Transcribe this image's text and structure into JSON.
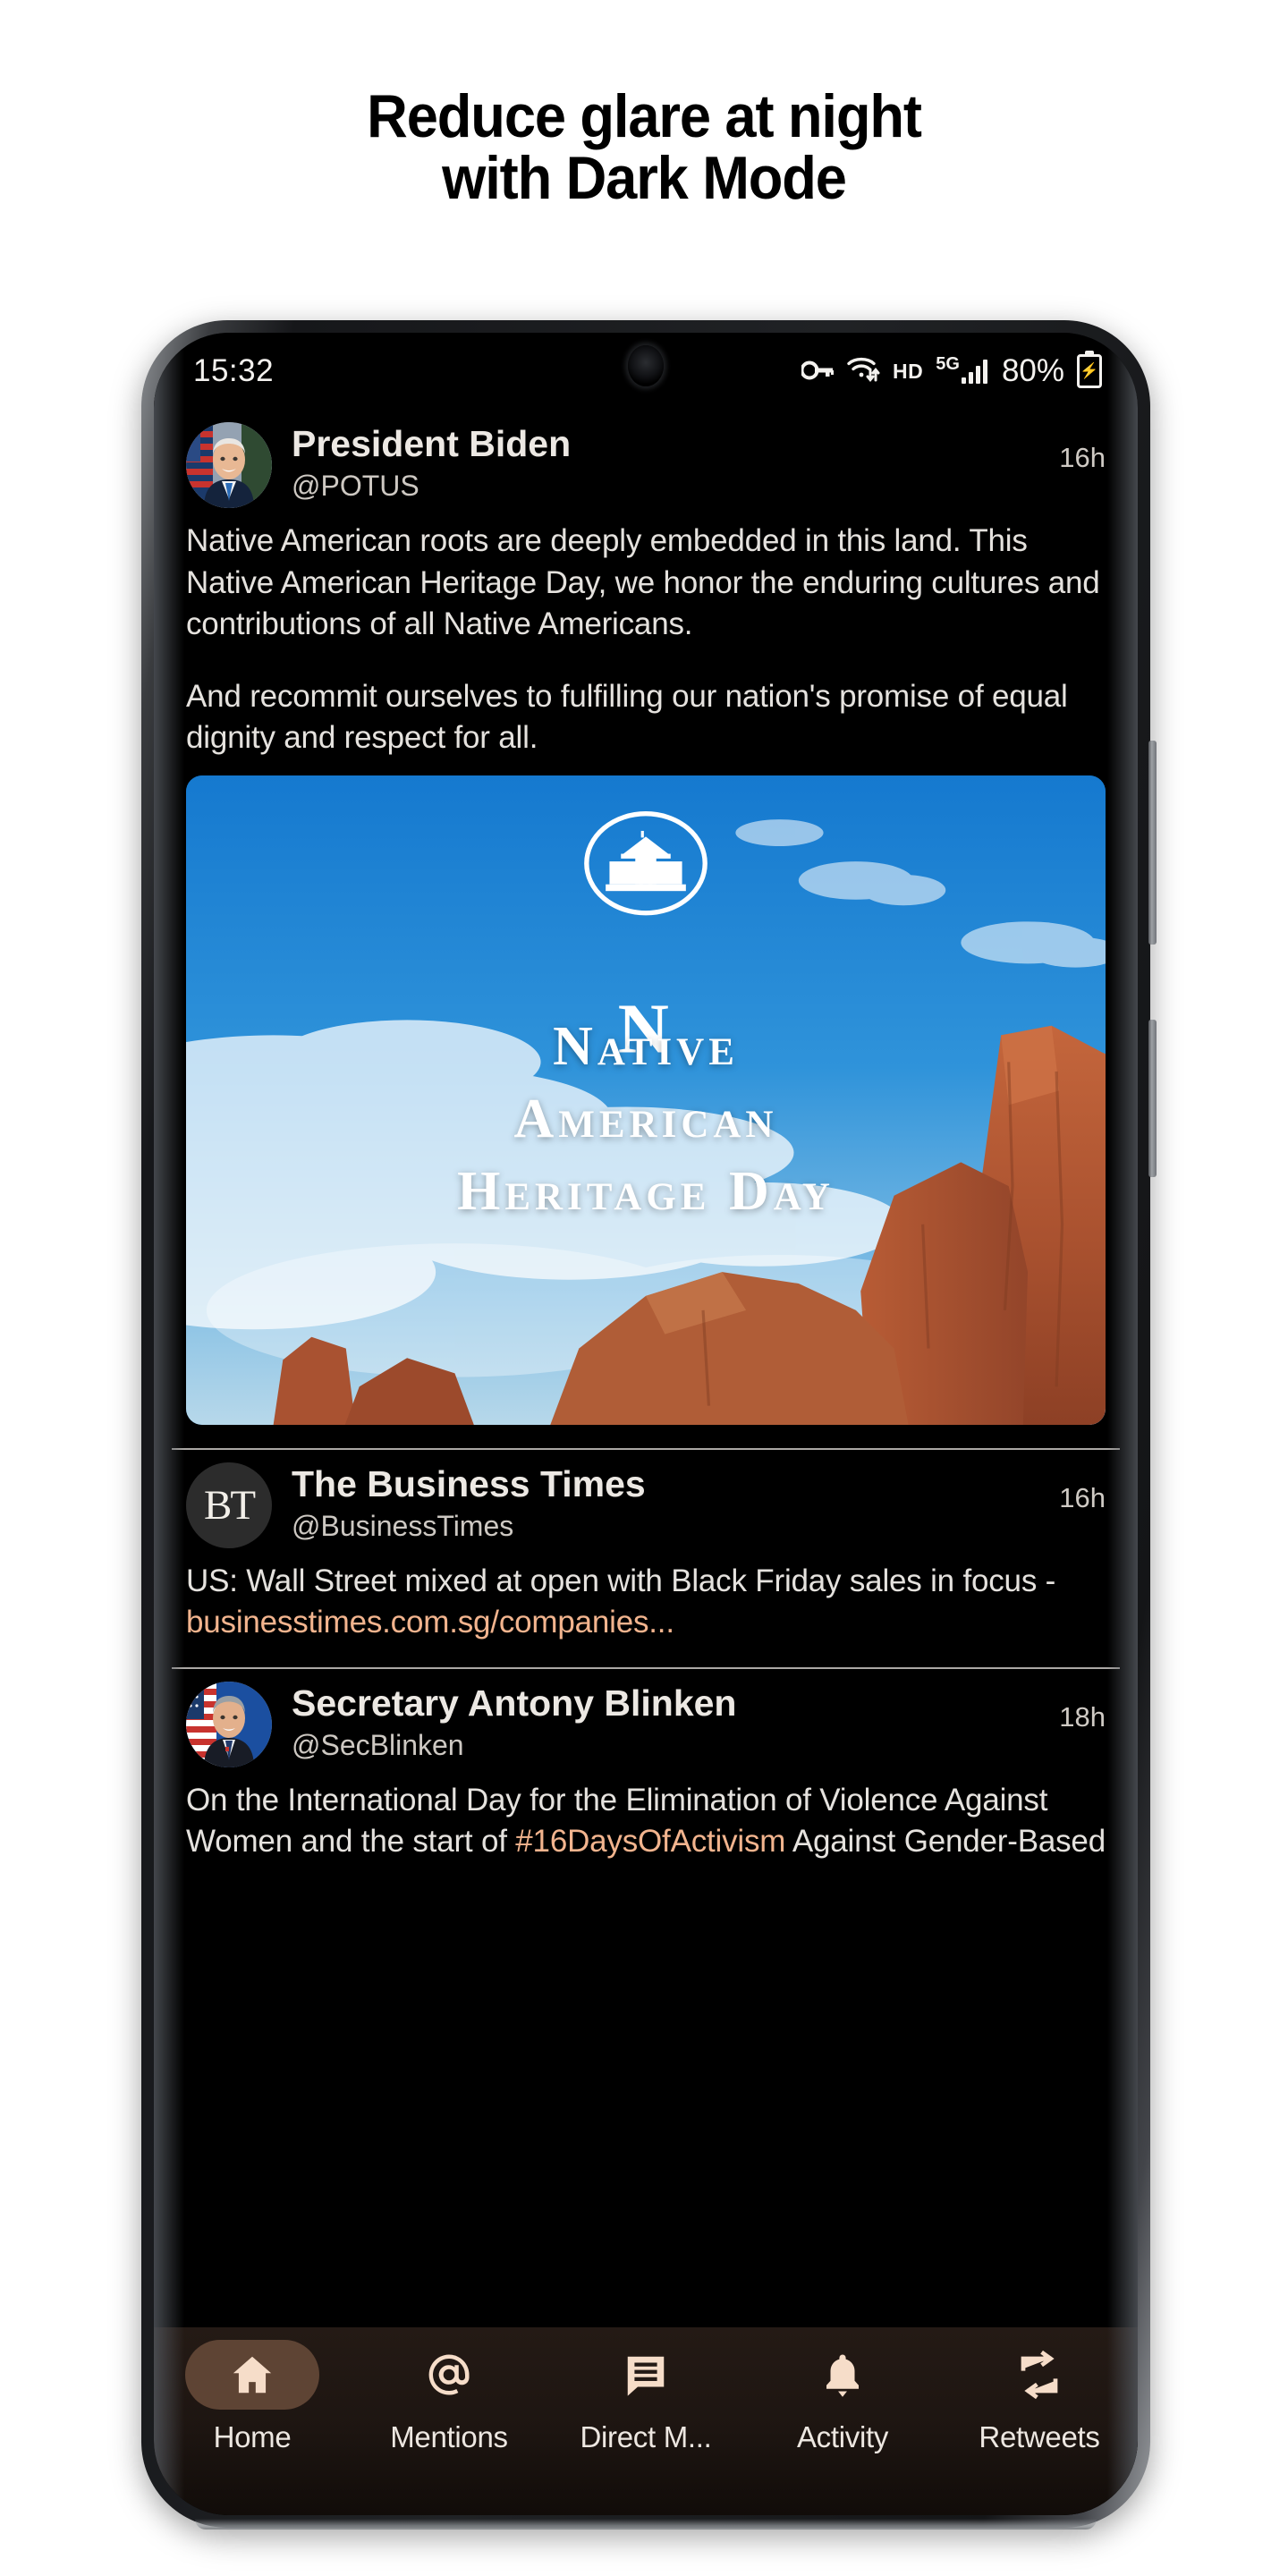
{
  "headline": {
    "line1": "Reduce glare at night",
    "line2": "with Dark Mode"
  },
  "statusbar": {
    "time": "15:32",
    "vpn_icon": "key-icon",
    "wifi_icon": "wifi-icon",
    "hd_label": "HD",
    "network_label": "5G",
    "battery_percent": "80%",
    "battery_icon": "battery-charging-icon"
  },
  "colors": {
    "background": "#000000",
    "text": "#e8e6e3",
    "link": "#f2b48e",
    "hashtag": "#f2b48e",
    "nav_bar": "#1d1511",
    "nav_active_pill": "#5e4434",
    "nav_icon": "#f6ddc9",
    "divider": "#c9c6c2"
  },
  "tweets": [
    {
      "display_name": "President Biden",
      "handle": "@POTUS",
      "timestamp": "16h",
      "avatar_name": "avatar-president-biden",
      "paragraphs": [
        "Native American roots are deeply embedded in this land. This Native American Heritage Day, we honor the enduring cultures and contributions of all Native Americans.",
        "And recommit ourselves to fulfilling our nation's promise of equal dignity and respect for all."
      ],
      "media": {
        "name": "native-american-heritage-day-image",
        "seal_label": "white-house-seal-icon",
        "title_line1": "Native",
        "title_line2": "American",
        "title_line3": "Heritage Day"
      }
    },
    {
      "display_name": "The Business Times",
      "handle": "@BusinessTimes",
      "timestamp": "16h",
      "avatar_name": "avatar-business-times",
      "avatar_initials": "BT",
      "text_before_link": "US: Wall Street mixed at open with Black Friday sales in focus - ",
      "link_text": "businesstimes.com.sg/companies..."
    },
    {
      "display_name": "Secretary Antony Blinken",
      "handle": "@SecBlinken",
      "timestamp": "18h",
      "avatar_name": "avatar-antony-blinken",
      "text_before_hashtag": "On the International Day for the Elimination of Violence Against Women and the start of ",
      "hashtag_text": "#16DaysOfActivism",
      "text_after_hashtag": " Against Gender-Based"
    }
  ],
  "bottom_nav": {
    "items": [
      {
        "label": "Home",
        "icon": "home-icon",
        "active": true
      },
      {
        "label": "Mentions",
        "icon": "at-icon",
        "active": false
      },
      {
        "label": "Direct M...",
        "icon": "message-icon",
        "active": false
      },
      {
        "label": "Activity",
        "icon": "bell-icon",
        "active": false
      },
      {
        "label": "Retweets",
        "icon": "retweet-icon",
        "active": false
      }
    ]
  }
}
